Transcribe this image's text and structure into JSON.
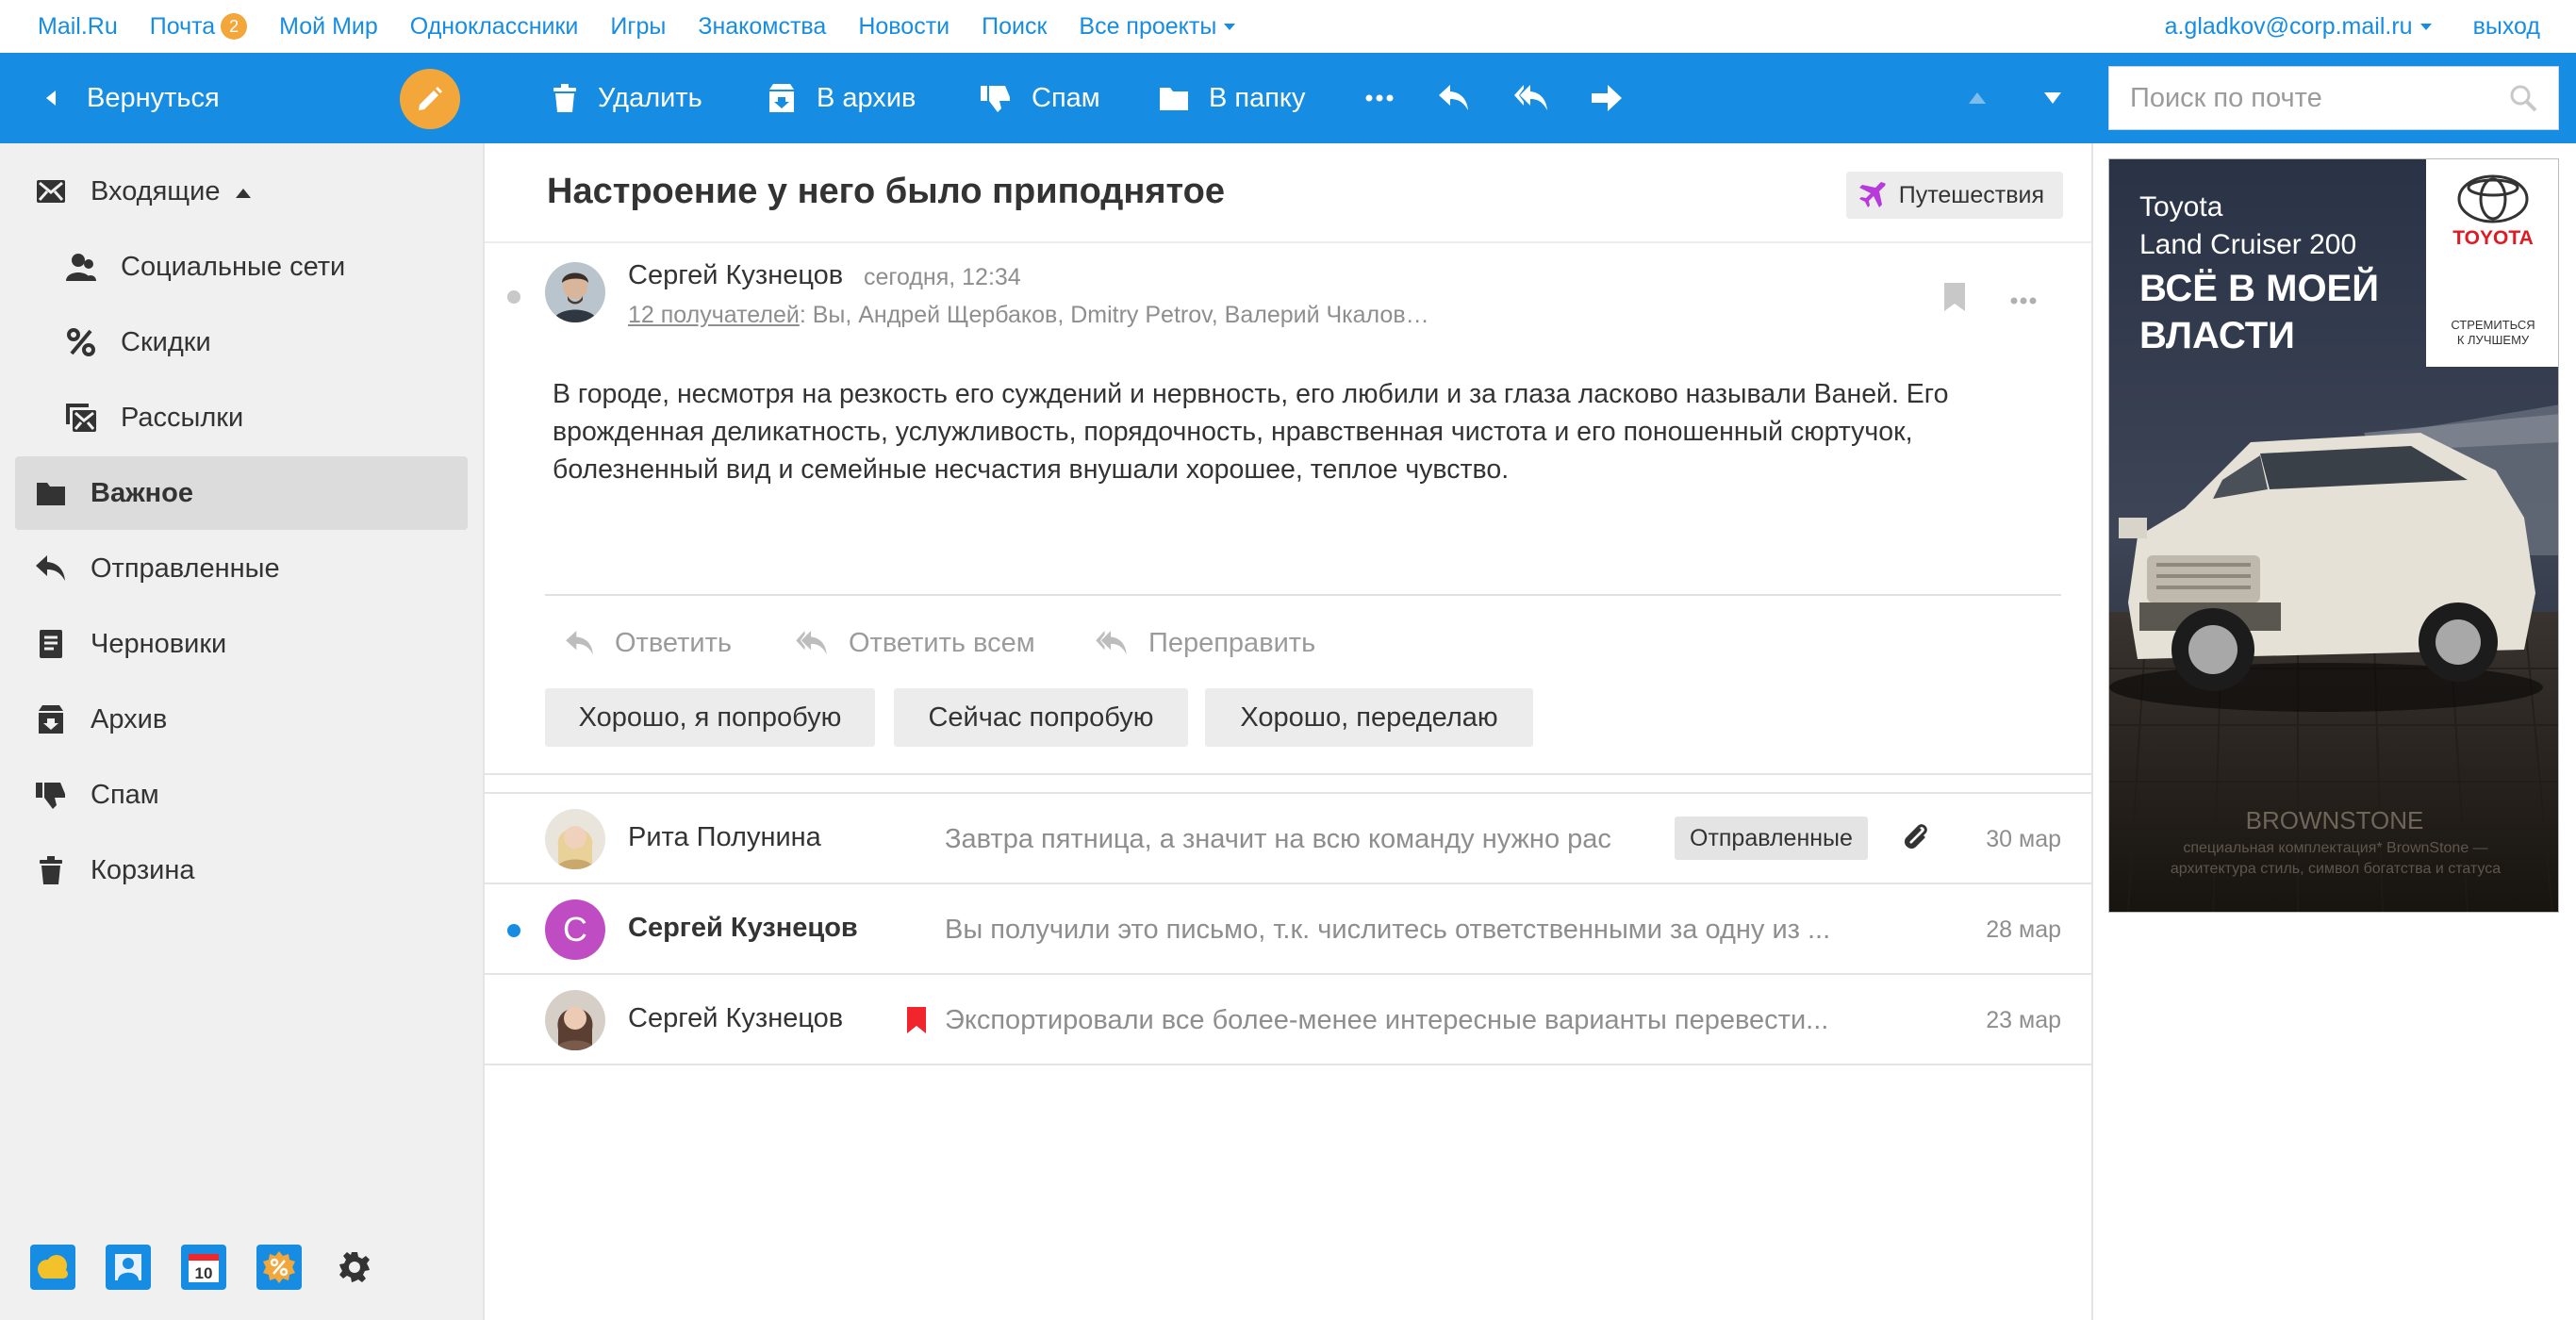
{
  "portal": {
    "links": [
      "Mail.Ru",
      "Почта",
      "Мой Мир",
      "Одноклассники",
      "Игры",
      "Знакомства",
      "Новости",
      "Поиск",
      "Все проекты"
    ],
    "mail_badge": "2",
    "user_email": "a.gladkov@corp.mail.ru",
    "logout": "выход"
  },
  "toolbar": {
    "back": "Вернуться",
    "delete": "Удалить",
    "archive": "В архив",
    "spam": "Спам",
    "move": "В папку",
    "search_placeholder": "Поиск по почте"
  },
  "sidebar": {
    "folders": [
      {
        "label": "Входящие",
        "icon": "inbox-icon"
      },
      {
        "label": "Социальные сети",
        "icon": "social-icon"
      },
      {
        "label": "Скидки",
        "icon": "percent-icon"
      },
      {
        "label": "Рассылки",
        "icon": "newsletter-icon"
      },
      {
        "label": "Важное",
        "icon": "folder-icon"
      },
      {
        "label": "Отправленные",
        "icon": "reply-icon"
      },
      {
        "label": "Черновики",
        "icon": "draft-icon"
      },
      {
        "label": "Архив",
        "icon": "archive-icon"
      },
      {
        "label": "Спам",
        "icon": "thumbs-down-icon"
      },
      {
        "label": "Корзина",
        "icon": "trash-icon"
      }
    ],
    "calendar_day": "10"
  },
  "letter": {
    "subject": "Настроение у него было приподнятое",
    "tag": "Путешествия",
    "sender": "Сергей Кузнецов",
    "date": "сегодня, 12:34",
    "recipients_count": "12 получателей",
    "recipients_rest": ": Вы, Андрей Щербаков, Dmitry Petrov, Валерий Чкалов…",
    "body": "В городе, несмотря на резкость его суждений и нервность, его любили и за глаза ласково называли Ваней. Его врожденная деликатность, услужливость, порядочность, нравственная чистота и его поношенный сюртучок, болезненный вид и семейные несчастия внушали хорошее, теплое чувство.",
    "reply": "Ответить",
    "reply_all": "Ответить всем",
    "forward": "Переправить",
    "quick_replies": [
      "Хорошо, я попробую",
      "Сейчас попробую",
      "Хорошо, переделаю"
    ]
  },
  "threads": [
    {
      "from": "Рита Полунина",
      "snippet": "Завтра пятница, а значит на всю команду нужно рас",
      "label": "Отправленные",
      "date": "30 мар"
    },
    {
      "from": "Сергей Кузнецов",
      "initial": "С",
      "snippet": "Вы получили это письмо, т.к. числитесь ответственными за одну из ...",
      "date": "28 мар"
    },
    {
      "from": "Сергей Кузнецов",
      "snippet": "Экспортировали все более-менее интересные варианты перевести...",
      "date": "23 мар"
    }
  ],
  "ad": {
    "model_line1": "Toyota",
    "model_line2": "Land Cruiser 200",
    "headline_line1": "ВСЁ В МОЕЙ",
    "headline_line2": "ВЛАСТИ",
    "brand": "TOYOTA",
    "slogan_line1": "СТРЕМИТЬСЯ",
    "slogan_line2": "К ЛУЧШЕМУ",
    "partner": "BROWNSTONE",
    "fine_print": "специальная комплектация* BrownStone — архитектура стиль, символ богатства и статуса"
  },
  "colors": {
    "accent": "#168de2",
    "compose": "#f3a73a",
    "unread_dot": "#168de2",
    "flag": "#f0262c",
    "tag_plane": "#b73bdb",
    "avatar_initial": "#c04cc4"
  }
}
